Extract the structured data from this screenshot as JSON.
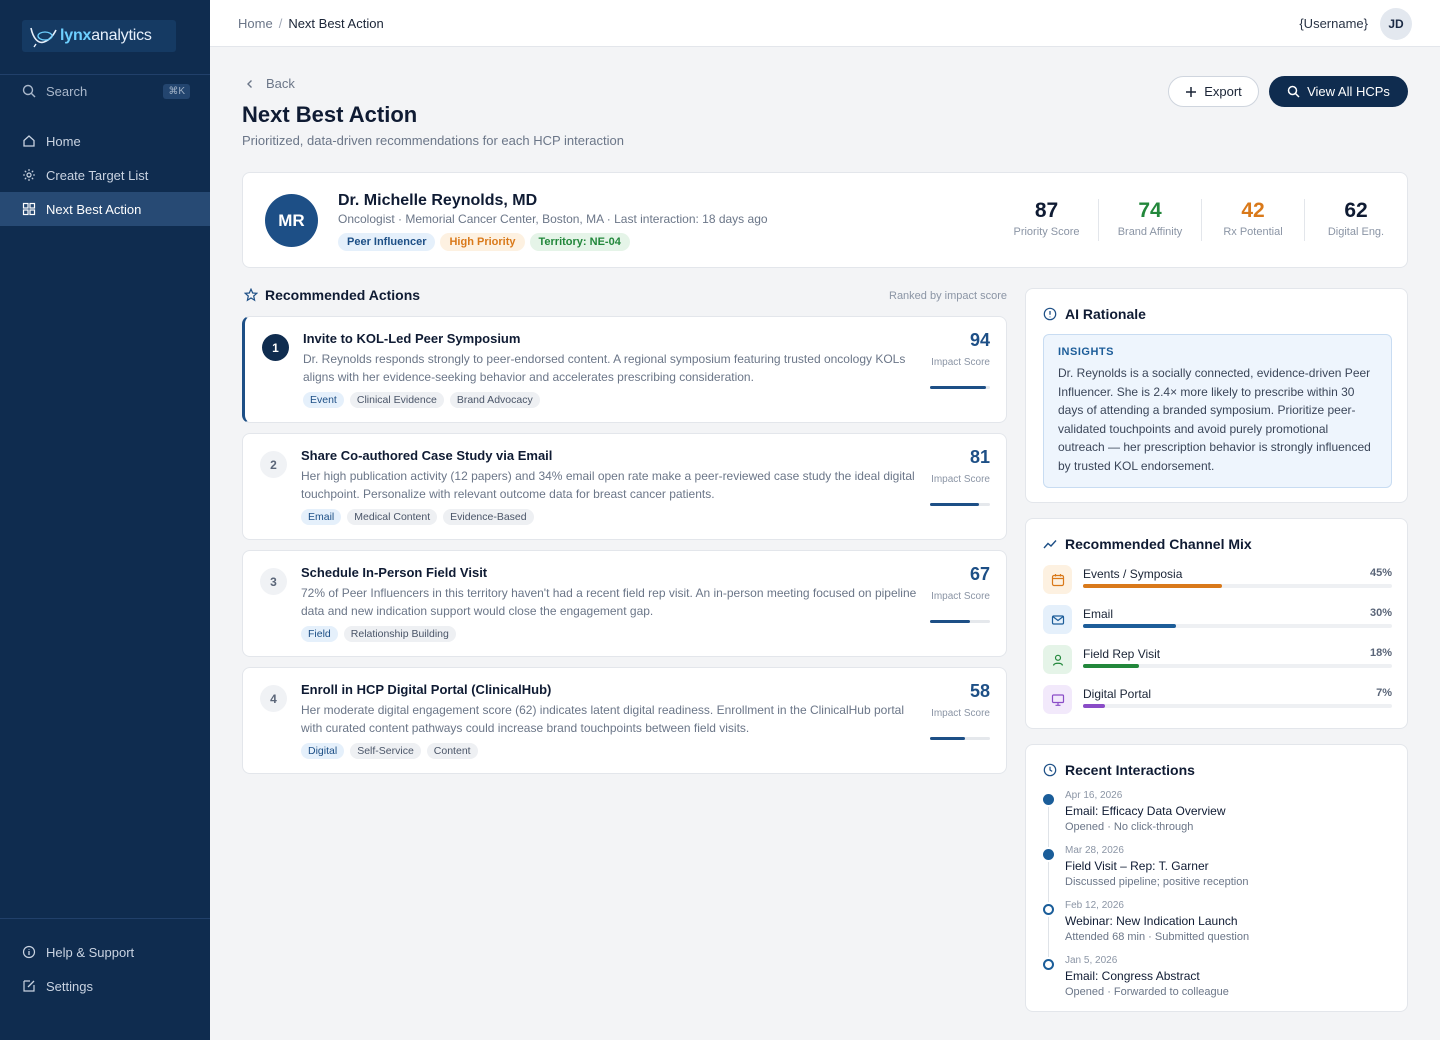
{
  "brand": {
    "logo_strong": "lynx",
    "logo_rest": "analytics"
  },
  "sidebar": {
    "search_label": "Search",
    "search_shortcut": "⌘K",
    "items": [
      {
        "label": "Home",
        "icon": "home-icon"
      },
      {
        "label": "Create Target List",
        "icon": "sparkle-icon"
      },
      {
        "label": "Next Best Action",
        "icon": "grid-icon",
        "active": true
      }
    ],
    "bottom_items": [
      {
        "label": "Help & Support",
        "icon": "info-icon"
      },
      {
        "label": "Settings",
        "icon": "edit-icon"
      }
    ]
  },
  "topbar": {
    "breadcrumb": [
      "Home",
      "Next Best Action"
    ],
    "username": "{Username}",
    "avatar_initials": "JD"
  },
  "header": {
    "back_label": "Back",
    "title": "Next Best Action",
    "subtitle": "Prioritized, data-driven recommendations for each HCP interaction",
    "export_label": "Export",
    "view_all_label": "View All HCPs"
  },
  "profile": {
    "initials": "MR",
    "name": "Dr. Michelle Reynolds, MD",
    "meta": "Oncologist · Memorial Cancer Center, Boston, MA · Last interaction: 18 days ago",
    "tags": [
      "Peer Influencer",
      "High Priority",
      "Territory: NE-04"
    ],
    "metrics": [
      {
        "value": "87",
        "label": "Priority Score",
        "color": "#0f1b33"
      },
      {
        "value": "74",
        "label": "Brand Affinity",
        "color": "#22873b"
      },
      {
        "value": "42",
        "label": "Rx Potential",
        "color": "#d9791a"
      },
      {
        "value": "62",
        "label": "Digital Eng.",
        "color": "#0f1b33"
      }
    ]
  },
  "actions_section": {
    "title": "Recommended Actions",
    "ranked_note": "Ranked by impact score",
    "score_label": "Impact Score"
  },
  "actions": [
    {
      "rank": "1",
      "title": "Invite to KOL-Led Peer Symposium",
      "description": "Dr. Reynolds responds strongly to peer-endorsed content. A regional symposium featuring trusted oncology KOLs aligns with her evidence-seeking behavior and accelerates prescribing consideration.",
      "tags": [
        "Event",
        "Clinical Evidence",
        "Brand Advocacy"
      ],
      "score": "94",
      "score_fraction": 0.94
    },
    {
      "rank": "2",
      "title": "Share Co-authored Case Study via Email",
      "description": "Her high publication activity (12 papers) and 34% email open rate make a peer-reviewed case study the ideal digital touchpoint. Personalize with relevant outcome data for breast cancer patients.",
      "tags": [
        "Email",
        "Medical Content",
        "Evidence-Based"
      ],
      "score": "81",
      "score_fraction": 0.81
    },
    {
      "rank": "3",
      "title": "Schedule In-Person Field Visit",
      "description": "72% of Peer Influencers in this territory haven't had a recent field rep visit. An in-person meeting focused on pipeline data and new indication support would close the engagement gap.",
      "tags": [
        "Field",
        "Relationship Building"
      ],
      "score": "67",
      "score_fraction": 0.67
    },
    {
      "rank": "4",
      "title": "Enroll in HCP Digital Portal (ClinicalHub)",
      "description": "Her moderate digital engagement score (62) indicates latent digital readiness. Enrollment in the ClinicalHub portal with curated content pathways could increase brand touchpoints between field visits.",
      "tags": [
        "Digital",
        "Self-Service",
        "Content"
      ],
      "score": "58",
      "score_fraction": 0.58
    }
  ],
  "ai_rationale": {
    "title": "AI Rationale",
    "insights_label": "INSIGHTS",
    "text": "Dr. Reynolds is a socially connected, evidence-driven Peer Influencer. She is 2.4× more likely to prescribe within 30 days of attending a branded symposium. Prioritize peer-validated touchpoints and avoid purely promotional outreach — her prescription behavior is strongly influenced by trusted KOL endorsement."
  },
  "channel_mix": {
    "title": "Recommended Channel Mix",
    "channels": [
      {
        "name": "Events / Symposia",
        "pct": "45%",
        "fraction": 0.45,
        "color": "#d9791a",
        "bg": "#fdf1e1",
        "icon": "calendar-icon"
      },
      {
        "name": "Email",
        "pct": "30%",
        "fraction": 0.3,
        "color": "#1d5d99",
        "bg": "#e5f0fb",
        "icon": "mail-icon"
      },
      {
        "name": "Field Rep Visit",
        "pct": "18%",
        "fraction": 0.18,
        "color": "#22873b",
        "bg": "#e5f4e8",
        "icon": "user-icon"
      },
      {
        "name": "Digital Portal",
        "pct": "7%",
        "fraction": 0.07,
        "color": "#8a4cc7",
        "bg": "#f2e9fb",
        "icon": "monitor-icon"
      }
    ]
  },
  "recent": {
    "title": "Recent Interactions",
    "items": [
      {
        "date": "Apr 16, 2026",
        "title": "Email: Efficacy Data Overview",
        "note": "Opened · No click-through",
        "filled": true
      },
      {
        "date": "Mar 28, 2026",
        "title": "Field Visit – Rep: T. Garner",
        "note": "Discussed pipeline; positive reception",
        "filled": true
      },
      {
        "date": "Feb 12, 2026",
        "title": "Webinar: New Indication Launch",
        "note": "Attended 68 min · Submitted question",
        "filled": false
      },
      {
        "date": "Jan 5, 2026",
        "title": "Email: Congress Abstract",
        "note": "Opened · Forwarded to colleague",
        "filled": false
      }
    ]
  }
}
